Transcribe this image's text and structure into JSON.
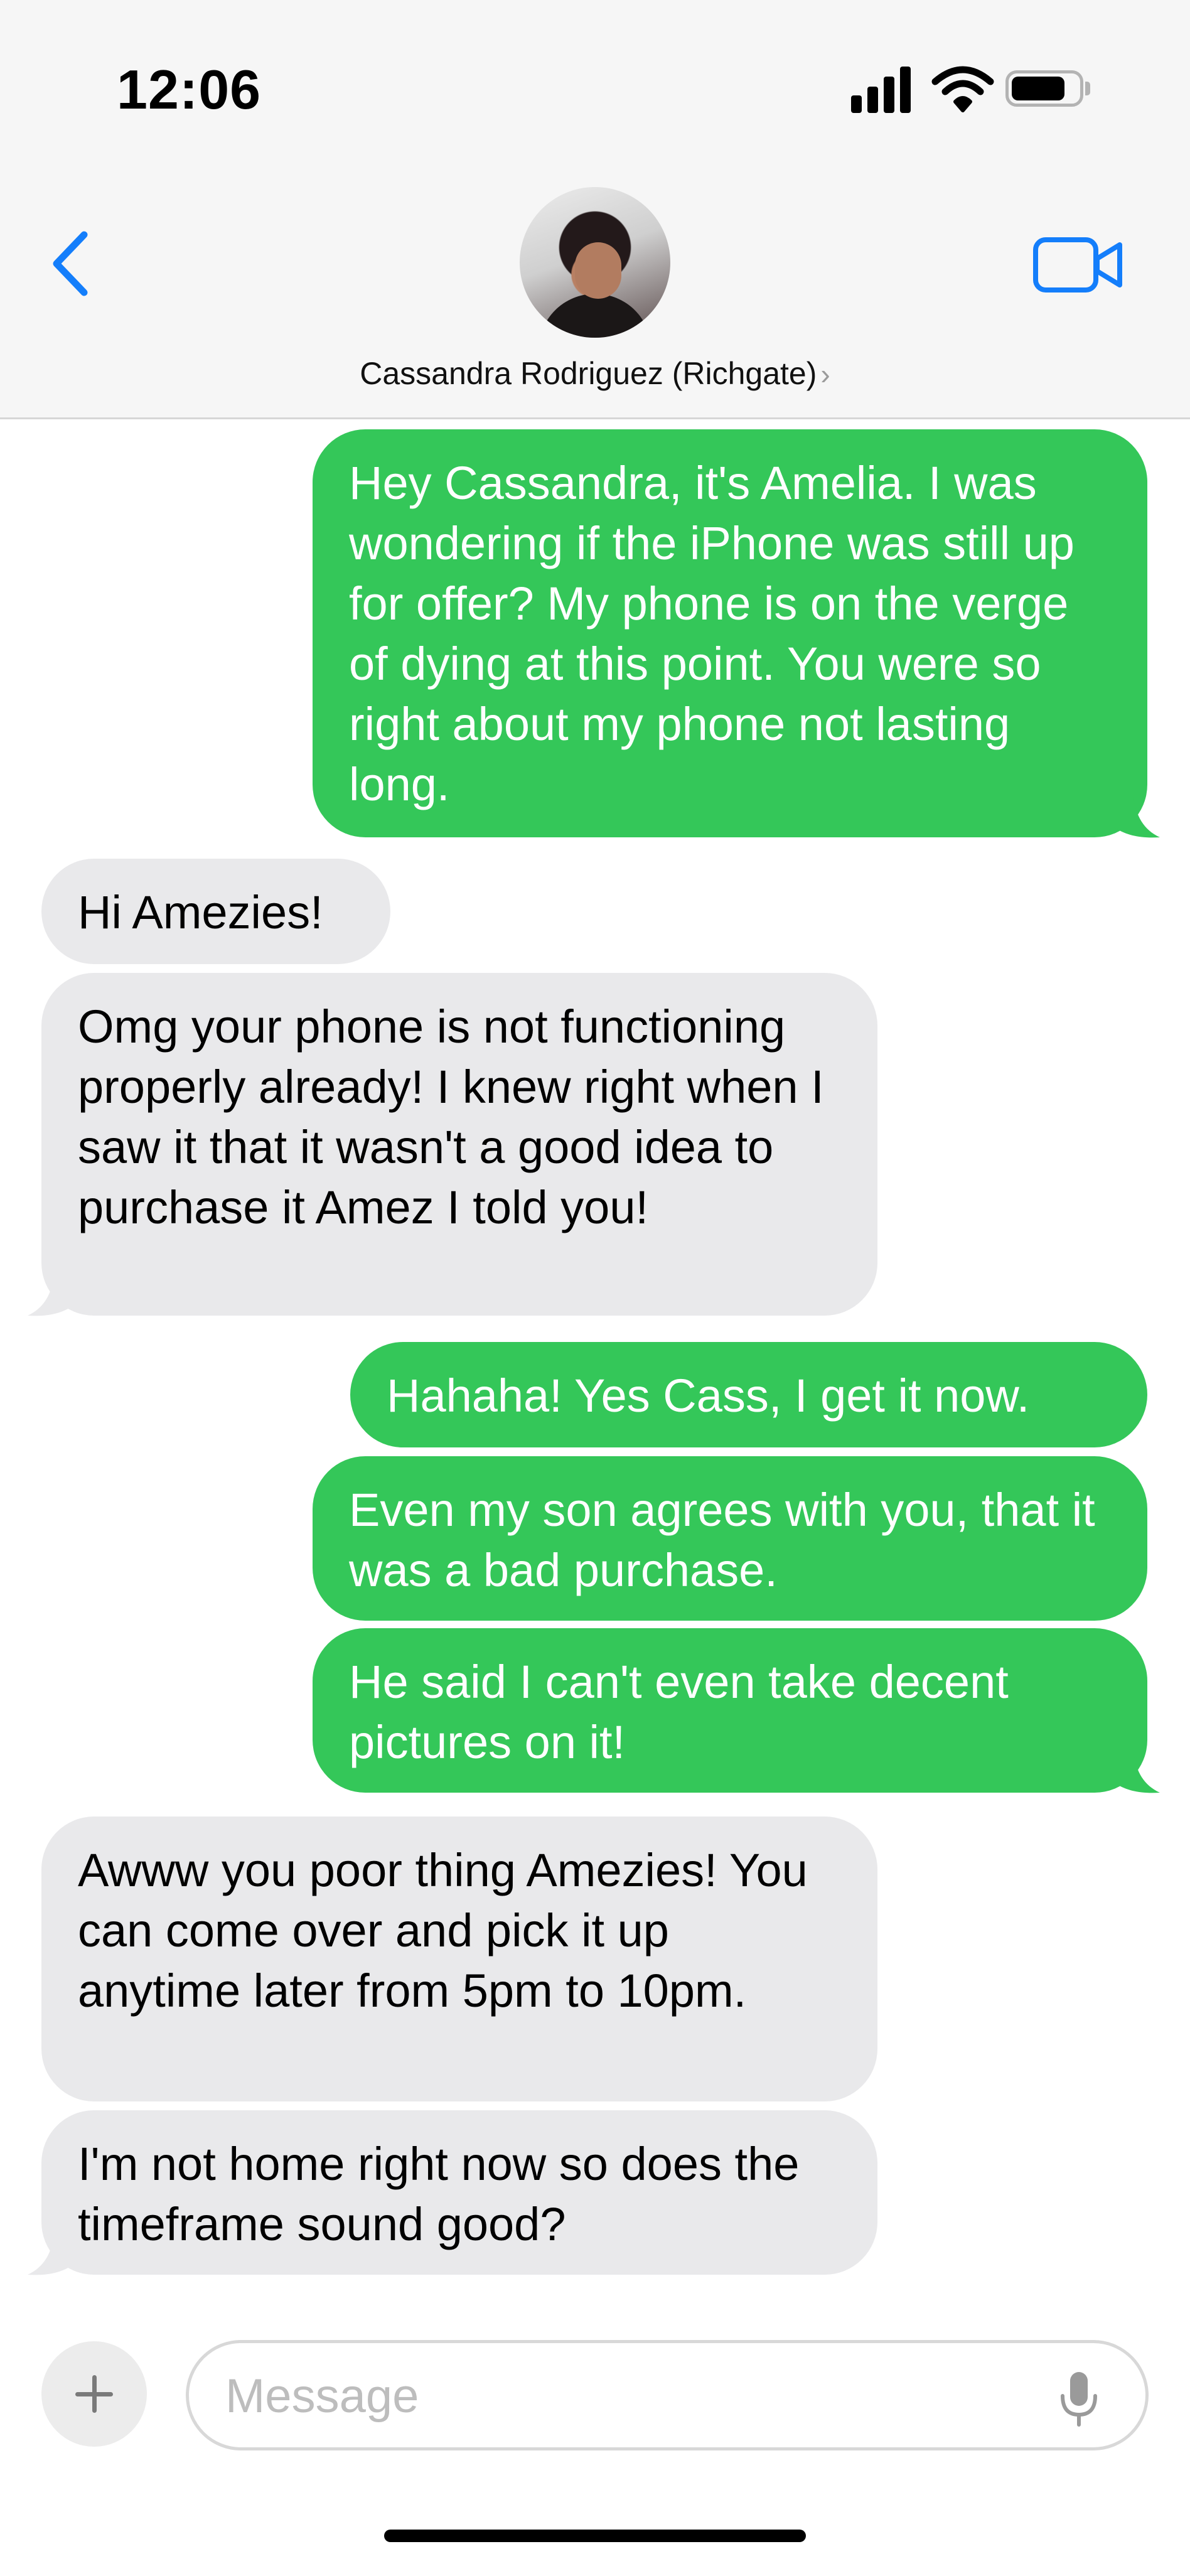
{
  "status_bar": {
    "time": "12:06"
  },
  "header": {
    "contact_name": "Cassandra Rodriguez (Richgate)",
    "contact_chevron": "›"
  },
  "messages": [
    {
      "from": "me",
      "text": "Hey Cassandra, it's Amelia. I was wondering if the iPhone was still up for offer? My phone is on the verge of dying at this point. You were so right about my phone not lasting long."
    },
    {
      "from": "them",
      "text": "Hi Amezies!"
    },
    {
      "from": "them",
      "text": "Omg your phone is not functioning properly already! I knew right when I saw it that it wasn't a good idea to purchase it Amez I told you!"
    },
    {
      "from": "me",
      "text": "Hahaha! Yes Cass, I get it now."
    },
    {
      "from": "me",
      "text": "Even my son agrees with you, that it was a bad purchase."
    },
    {
      "from": "me",
      "text": "He said I can't even take decent pictures on it!"
    },
    {
      "from": "them",
      "text": "Awww you poor thing Amezies! You can come over and pick it up anytime later from 5pm to 10pm."
    },
    {
      "from": "them",
      "text": "I'm not home right now so does the timeframe sound good?"
    }
  ],
  "composer": {
    "placeholder": "Message",
    "value": ""
  },
  "colors": {
    "outgoing_bubble": "#34c759",
    "incoming_bubble": "#e9e9eb",
    "accent": "#147efb"
  },
  "icons": {
    "back": "chevron-left-icon",
    "video": "video-camera-icon",
    "add": "plus-icon",
    "mic": "microphone-icon"
  }
}
